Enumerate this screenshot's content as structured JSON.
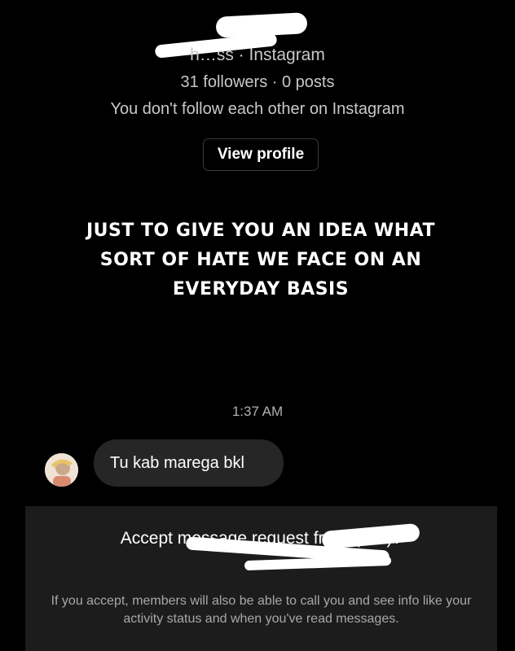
{
  "profile": {
    "subtitle": "h…ss · Instagram",
    "stats": "31 followers · 0 posts",
    "follow_status": "You don't follow each other on Instagram",
    "view_profile_label": "View profile"
  },
  "banner_text": "JUST TO GIVE YOU AN IDEA WHAT SORT OF HATE WE FACE ON AN EVERYDAY BASIS",
  "conversation": {
    "timestamp": "1:37 AM",
    "message": "Tu kab marega bkl"
  },
  "request": {
    "title": "Accept message request fr…ti (h…)?",
    "info": "If you accept, members will also be able to call you and see info like your activity status and when you've read messages."
  }
}
